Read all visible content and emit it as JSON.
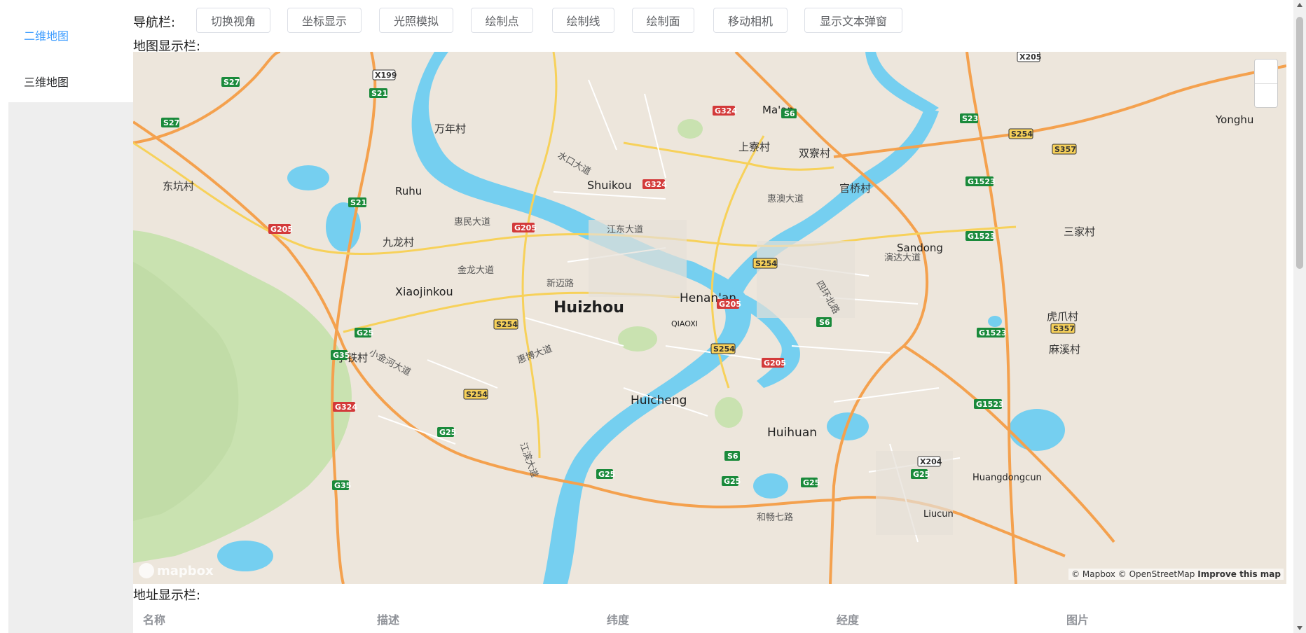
{
  "sidebar": {
    "items": [
      {
        "label": "二维地图",
        "active": true
      },
      {
        "label": "三维地图",
        "active": false
      }
    ]
  },
  "nav": {
    "label": "导航栏:",
    "buttons": [
      "切换视角",
      "坐标显示",
      "光照模拟",
      "绘制点",
      "绘制线",
      "绘制面",
      "移动相机",
      "显示文本弹窗"
    ]
  },
  "map_section": {
    "label": "地图显示栏:",
    "cities": [
      "Huizhou",
      "Henan'an",
      "Huicheng",
      "Huihuan",
      "Shuikou",
      "Xiaojinkou",
      "Ruhu",
      "Sandong",
      "Ma'an",
      "Yonghu",
      "Liucun",
      "Huangdongcun",
      "QIAOXI"
    ],
    "villages": [
      "万年村",
      "东坑村",
      "九龙村",
      "小铁村",
      "双寮村",
      "上寮村",
      "官桥村",
      "三家村",
      "虎爪村",
      "麻溪村"
    ],
    "roads": [
      "惠民大道",
      "金龙大道",
      "新迈路",
      "江东大道",
      "惠澳大道",
      "演达大道",
      "小金河大道",
      "惠博大道",
      "江滨大道",
      "水口大道",
      "四环北路",
      "和畅七路"
    ],
    "shields": [
      "S27",
      "X199",
      "S21",
      "G205",
      "G324",
      "S6",
      "S23",
      "S254",
      "S357",
      "G1523",
      "G25",
      "G35",
      "X205",
      "X204"
    ],
    "attribution": {
      "mapbox": "© Mapbox",
      "osm": "© OpenStreetMap",
      "improve": "Improve this map"
    },
    "logo_text": "mapbox"
  },
  "address_section": {
    "label": "地址显示栏:",
    "columns": [
      "名称",
      "描述",
      "纬度",
      "经度",
      "图片"
    ]
  },
  "colors": {
    "active": "#409eff",
    "water": "#75cff0",
    "park": "#c9e2b0",
    "highway": "#f4a14e",
    "major_road": "#f7d15a"
  }
}
